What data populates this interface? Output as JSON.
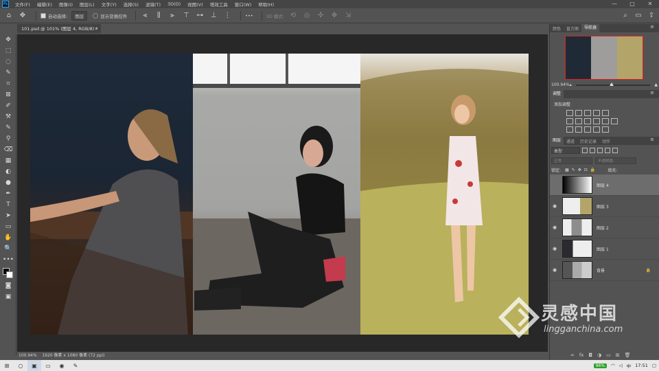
{
  "app": {
    "logo": "Ps"
  },
  "menu": [
    "文件(F)",
    "编辑(E)",
    "图像(I)",
    "图层(L)",
    "文字(Y)",
    "选择(S)",
    "滤镜(T)",
    "3D(D)",
    "视图(V)",
    "增效工具",
    "窗口(W)",
    "帮助(H)"
  ],
  "window_controls": {
    "minimize": "—",
    "maximize": "□",
    "close": "✕"
  },
  "options": {
    "auto_select_label": "自动选择:",
    "auto_select_value": "图层",
    "show_transform_label": "显示变换控件",
    "more": "•••",
    "mode_3d_label": "3D 模式:"
  },
  "document_tab": {
    "title": "101.psd @ 101% (图层 4, RGB/8) *",
    "close": "×"
  },
  "status": {
    "zoom": "100.94%",
    "doc_info": "1920 像素 x 1080 像素 (72 ppi)"
  },
  "tools": [
    "✥",
    "⬚",
    "◌",
    "✎",
    "⌗",
    "⊠",
    "✐",
    "⚒",
    "✎",
    "⚲",
    "⌫",
    "▦",
    "◐",
    "●",
    "✒",
    "T",
    "➤",
    "▭",
    "✋",
    "🔍",
    "•••"
  ],
  "panels": {
    "top_tabs": [
      "颜色",
      "直方图",
      "导航器"
    ],
    "active_top_tab": "导航器",
    "nav_zoom": "100.94%",
    "adjust_tab": "调整",
    "adjust_title": "添加调整",
    "layer_tabs": [
      "图层",
      "通道",
      "历史记录",
      "动作"
    ],
    "filter_kind": "类型",
    "blend_mode": "正常",
    "opacity_label": "不透明度:",
    "lock_label": "锁定:",
    "fill_label": "填充:"
  },
  "layers": [
    {
      "name": "图层 4",
      "visible": false,
      "selected": true
    },
    {
      "name": "图层 3",
      "visible": true,
      "selected": false
    },
    {
      "name": "图层 2",
      "visible": true,
      "selected": false
    },
    {
      "name": "图层 1",
      "visible": true,
      "selected": false
    },
    {
      "name": "背景",
      "visible": true,
      "selected": false,
      "locked": true
    }
  ],
  "layer_bottom_icons": [
    "∞",
    "fx",
    "◘",
    "◑",
    "▭",
    "⊞",
    "🗑"
  ],
  "taskbar": {
    "battery": "96%",
    "ime": "中",
    "time": "17:51"
  },
  "watermark": {
    "cn": "灵感中国",
    "en": "lingganchina.com"
  }
}
